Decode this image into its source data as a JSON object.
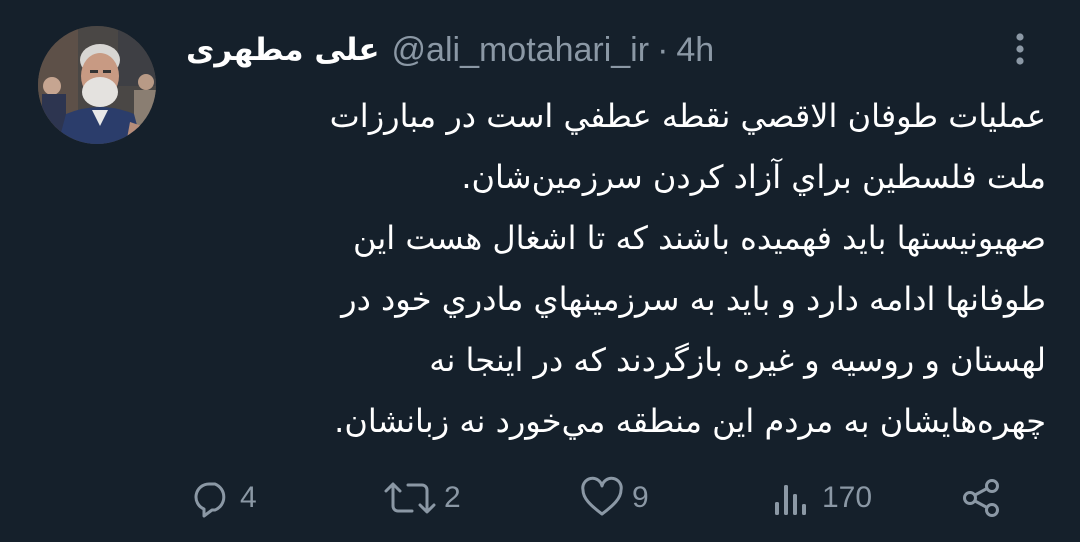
{
  "tweet": {
    "display_name": "علی مطهری",
    "handle": "@ali_motahari_ir",
    "separator": "·",
    "time": "4h",
    "lines": [
      "عمليات طوفان الاقصي نقطه عطفي است در مبارزات",
      "ملت فلسطين براي آزاد كردن سرزمين‌شان.",
      "صهيونيستها بايد فهميده باشند كه تا اشغال هست اين",
      "طوفانها ادامه دارد و بايد به سرزمينهاي مادري خود در",
      "لهستان و روسيه و غيره بازگردند كه در اينجا نه",
      "چهره‌هايشان به مردم اين منطقه مي‌خورد نه زبانشان."
    ]
  },
  "actions": {
    "reply_count": "4",
    "retweet_count": "2",
    "like_count": "9",
    "views_count": "170"
  },
  "icons": {
    "more": "more-vertical-icon",
    "reply": "reply-icon",
    "retweet": "retweet-icon",
    "like": "heart-icon",
    "views": "views-icon",
    "share": "share-icon"
  },
  "colors": {
    "background": "#15202b",
    "text": "#ffffff",
    "muted": "#8b98a5"
  }
}
